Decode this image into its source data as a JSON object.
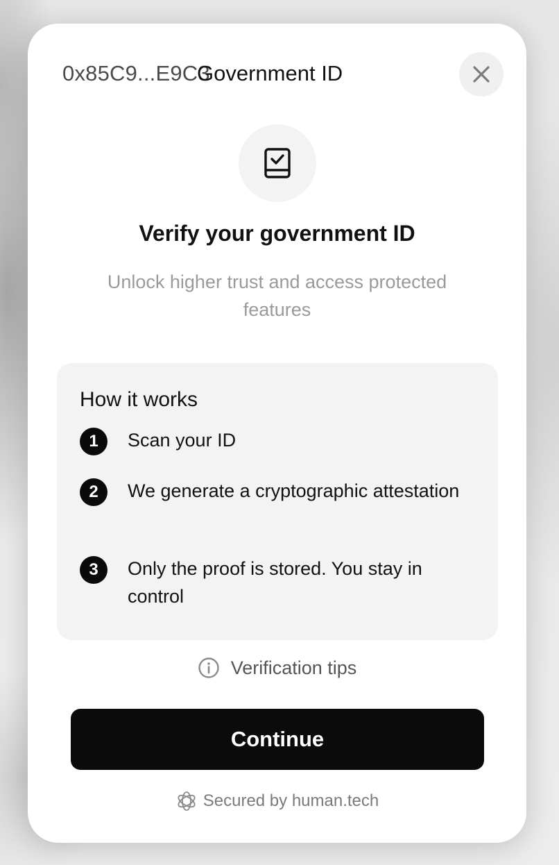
{
  "header": {
    "address": "0x85C9...E9C3",
    "title": "Government ID"
  },
  "icons": {
    "close": "close-icon",
    "hero": "id-card-check-icon",
    "info": "info-icon",
    "brand": "human-tech-logo-icon"
  },
  "main": {
    "heading": "Verify your government ID",
    "subheading": "Unlock higher trust and access protected features"
  },
  "how_it_works": {
    "title": "How it works",
    "steps": [
      {
        "number": "1",
        "text": "Scan your ID"
      },
      {
        "number": "2",
        "text": "We generate a cryptographic attestation"
      },
      {
        "number": "3",
        "text": "Only the proof is stored. You stay in control"
      }
    ]
  },
  "tips": {
    "label": "Verification tips"
  },
  "actions": {
    "continue_label": "Continue"
  },
  "footer": {
    "label": "Secured by human.tech"
  },
  "colors": {
    "primary_button": "#0b0b0b",
    "card_background": "#f3f3f3",
    "muted_text": "#9a9a9a"
  }
}
